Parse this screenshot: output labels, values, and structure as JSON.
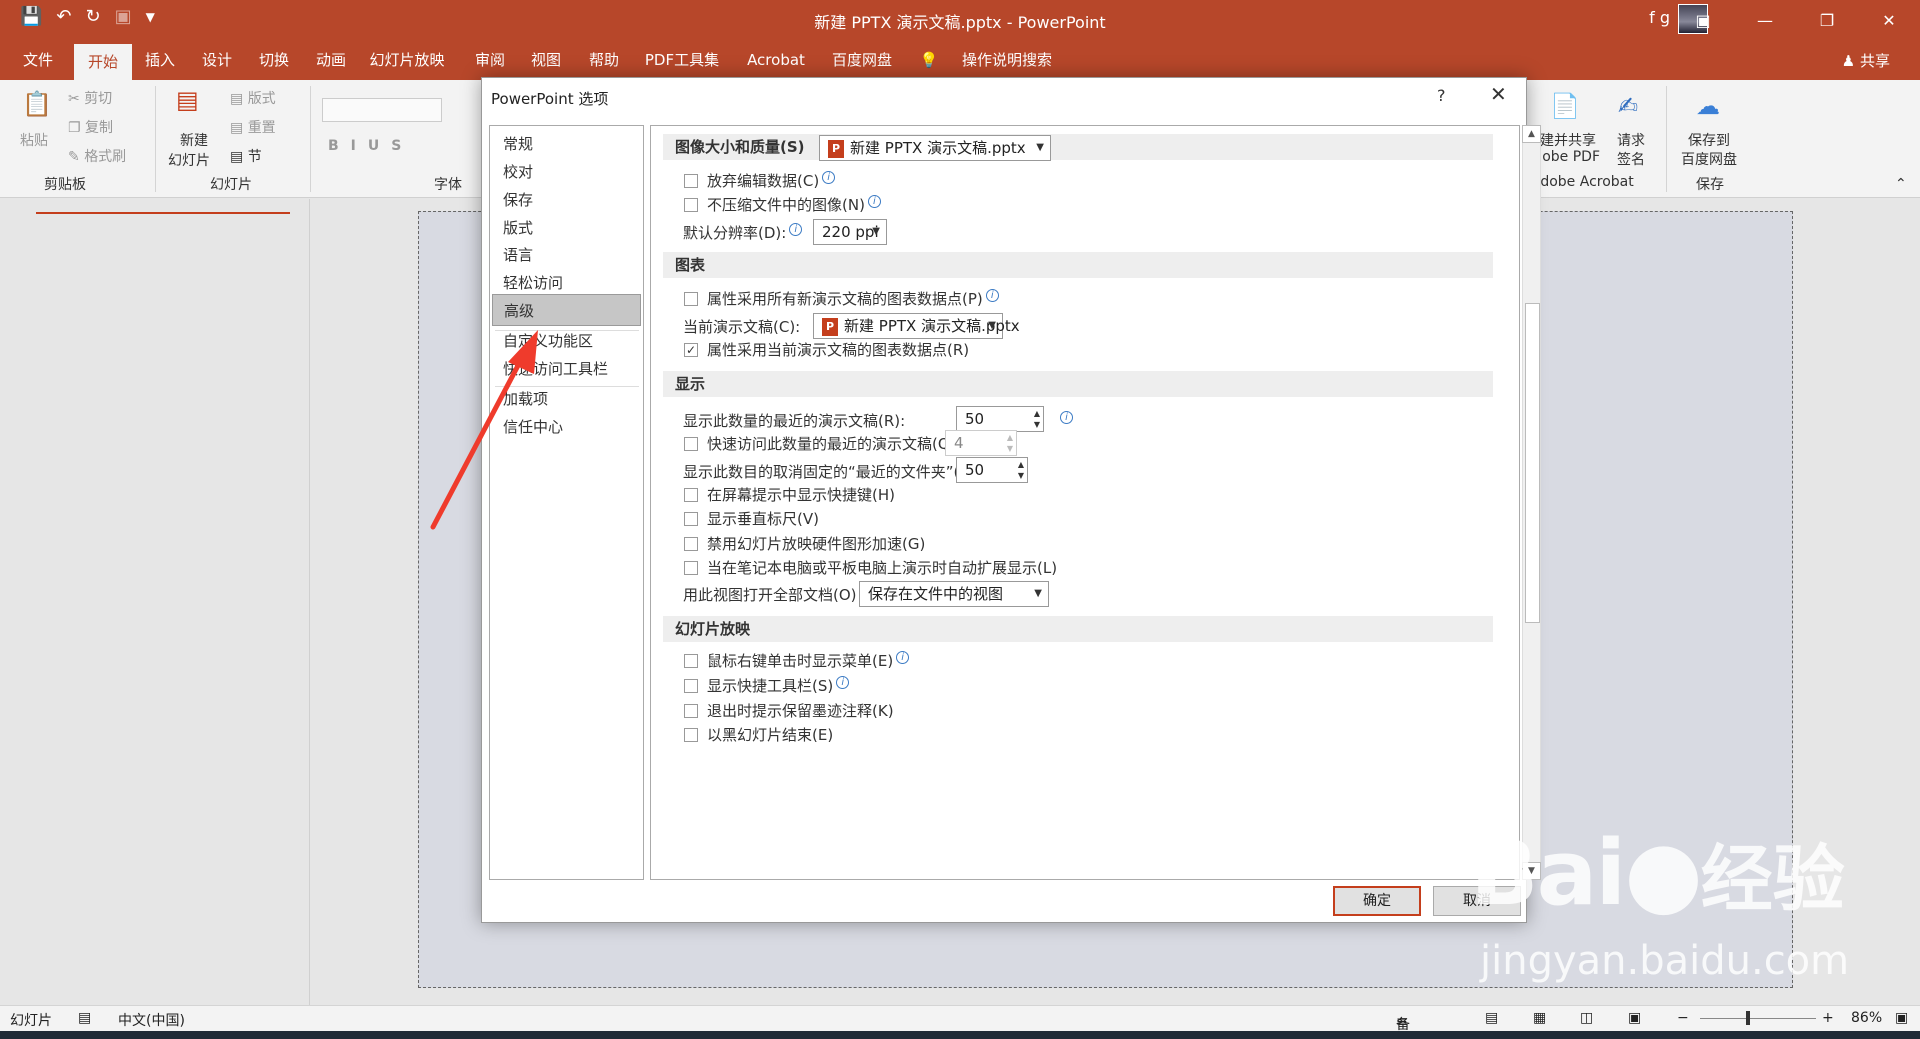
{
  "app": {
    "title": "新建 PPTX 演示文稿.pptx  -  PowerPoint",
    "user": "f g",
    "accent": "#b7472a"
  },
  "qat": [
    "save-icon",
    "undo-icon",
    "redo-icon",
    "slideshow-icon",
    "customize-icon"
  ],
  "tabs": [
    "文件",
    "开始",
    "插入",
    "设计",
    "切换",
    "动画",
    "幻灯片放映",
    "审阅",
    "视图",
    "帮助",
    "PDF工具集",
    "Acrobat",
    "百度网盘",
    "操作说明搜索"
  ],
  "share": "共享",
  "ribbon": {
    "paste": "粘贴",
    "cut": "剪切",
    "copy": "复制",
    "format_painter": "格式刷",
    "clipboard": "剪贴板",
    "new_slide_line1": "新建",
    "new_slide_line2": "幻灯片",
    "layout": "版式",
    "reset": "重置",
    "section": "节",
    "slides": "幻灯片",
    "font_group": "字体",
    "create_share_line1": "创建并共享",
    "create_share_line2": "Adobe PDF",
    "request_sign_line1": "请求",
    "request_sign_line2": "签名",
    "adobe_group": "Adobe Acrobat",
    "save_baidu_line1": "保存到",
    "save_baidu_line2": "百度网盘",
    "save_group": "保存"
  },
  "dialog": {
    "title": "PowerPoint 选项",
    "help": "?",
    "nav": [
      "常规",
      "校对",
      "保存",
      "版式",
      "语言",
      "轻松访问",
      "高级",
      "自定义功能区",
      "快速访问工具栏",
      "加载项",
      "信任中心"
    ],
    "selected_nav": "高级",
    "ok": "确定",
    "cancel": "取消"
  },
  "sections": {
    "image": {
      "heading": "图像大小和质量(S)",
      "file": "新建 PPTX 演示文稿.pptx",
      "discard_edit": "放弃编辑数据(C)",
      "no_compress": "不压缩文件中的图像(N)",
      "resolution_label": "默认分辨率(D):",
      "resolution": "220 ppi"
    },
    "chart": {
      "heading": "图表",
      "all_new": "属性采用所有新演示文稿的图表数据点(P)",
      "current_label": "当前演示文稿(C):",
      "current_file": "新建 PPTX 演示文稿.pptx",
      "current_prop": "属性采用当前演示文稿的图表数据点(R)"
    },
    "display": {
      "heading": "显示",
      "recent_label": "显示此数量的最近的演示文稿(R):",
      "recent_value": "50",
      "quick_access_label": "快速访问此数量的最近的演示文稿(Q):",
      "quick_access_value": "4",
      "unpinned_label": "显示此数目的取消固定的“最近的文件夹”(F):",
      "unpinned_value": "50",
      "shortcut_tips": "在屏幕提示中显示快捷键(H)",
      "vertical_ruler": "显示垂直标尺(V)",
      "disable_hw": "禁用幻灯片放映硬件图形加速(G)",
      "auto_extend": "当在笔记本电脑或平板电脑上演示时自动扩展显示(L)",
      "open_view_label": "用此视图打开全部文档(O)",
      "open_view": "保存在文件中的视图"
    },
    "slideshow": {
      "heading": "幻灯片放映",
      "right_click": "鼠标右键单击时显示菜单(E)",
      "popup_toolbar": "显示快捷工具栏(S)",
      "keep_ink": "退出时提示保留墨迹注释(K)",
      "end_black": "以黑幻灯片结束(E)"
    }
  },
  "status": {
    "slide": "幻灯片",
    "language": "中文(中国)",
    "notes": "备注",
    "zoom": "86%"
  },
  "watermark": {
    "brand": "Bai",
    "brand2": "经验",
    "url": "jingyan.baidu.com"
  }
}
